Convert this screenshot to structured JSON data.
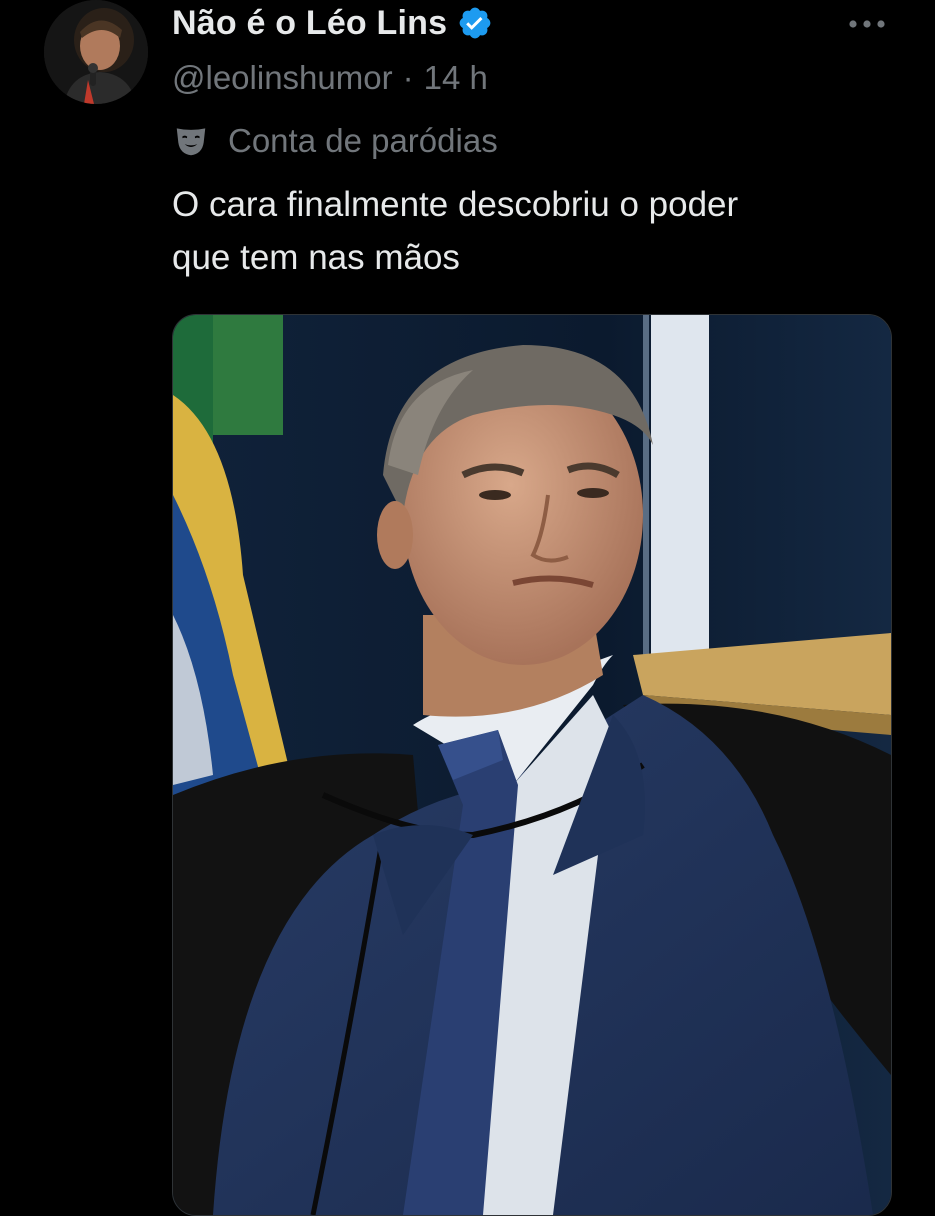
{
  "tweet": {
    "author": {
      "display_name": "Não é o Léo Lins",
      "handle": "@leolinshumor",
      "separator": "·",
      "time_ago": "14 h",
      "verified_icon": "verified-badge-icon",
      "verified_color": "#1d9bf0"
    },
    "label": {
      "icon": "parody-mask-icon",
      "text": "Conta de paródias"
    },
    "text_lines": [
      "O cara finalmente descobriu o poder",
      "que tem nas mãos"
    ],
    "more_icon": "more-options-icon"
  },
  "colors": {
    "background": "#000000",
    "primary_text": "#e7e9ea",
    "secondary_text": "#71767b",
    "accent": "#1d9bf0",
    "border": "#2f3336"
  }
}
